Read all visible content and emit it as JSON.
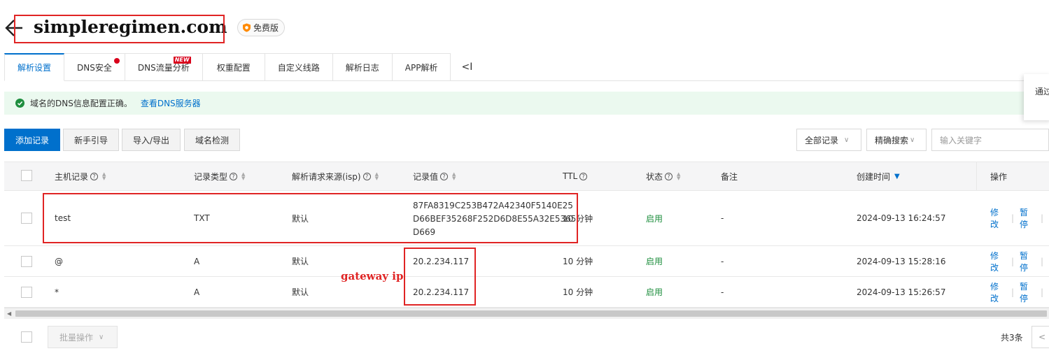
{
  "header": {
    "domain": "simpleregimen.com",
    "badge": "免费版"
  },
  "tabs": [
    {
      "label": "解析设置",
      "active": true
    },
    {
      "label": "DNS安全",
      "dot": true
    },
    {
      "label": "DNS流量分析",
      "flag": "NEW"
    },
    {
      "label": "权重配置"
    },
    {
      "label": "自定义线路"
    },
    {
      "label": "解析日志"
    },
    {
      "label": "APP解析"
    }
  ],
  "tabs_collapse": "<I",
  "alert": {
    "text": "域名的DNS信息配置正确。",
    "link": "查看DNS服务器"
  },
  "side_popup": "通过",
  "toolbar": {
    "add": "添加记录",
    "guide": "新手引导",
    "import_export": "导入/导出",
    "check": "域名检测",
    "filter": "全部记录",
    "search_mode": "精确搜索",
    "search_placeholder": "输入关键字"
  },
  "table": {
    "columns": [
      "主机记录",
      "记录类型",
      "解析请求来源(isp)",
      "记录值",
      "TTL",
      "状态",
      "备注",
      "创建时间",
      "操作"
    ],
    "rows": [
      {
        "host": "test",
        "type": "TXT",
        "isp": "默认",
        "value_lines": [
          "87FA8319C253B472A42340F5140E25",
          "D66BEF35268F252D6D8E55A32E5365",
          "D669"
        ],
        "ttl": "10 分钟",
        "status": "启用",
        "note": "-",
        "created": "2024-09-13 16:24:57",
        "op_edit": "修改",
        "op_pause": "暂停"
      },
      {
        "host": "@",
        "type": "A",
        "isp": "默认",
        "value": "20.2.234.117",
        "ttl": "10 分钟",
        "status": "启用",
        "note": "-",
        "created": "2024-09-13 15:28:16",
        "op_edit": "修改",
        "op_pause": "暂停"
      },
      {
        "host": "*",
        "type": "A",
        "isp": "默认",
        "value": "20.2.234.117",
        "ttl": "10 分钟",
        "status": "启用",
        "note": "-",
        "created": "2024-09-13 15:26:57",
        "op_edit": "修改",
        "op_pause": "暂停"
      }
    ]
  },
  "annotation": "gateway ip",
  "footer": {
    "batch": "批量操作",
    "total": "共3条"
  },
  "colors": {
    "accent": "#0070cc",
    "annotation": "#e02424",
    "success": "#1e8e3e"
  }
}
